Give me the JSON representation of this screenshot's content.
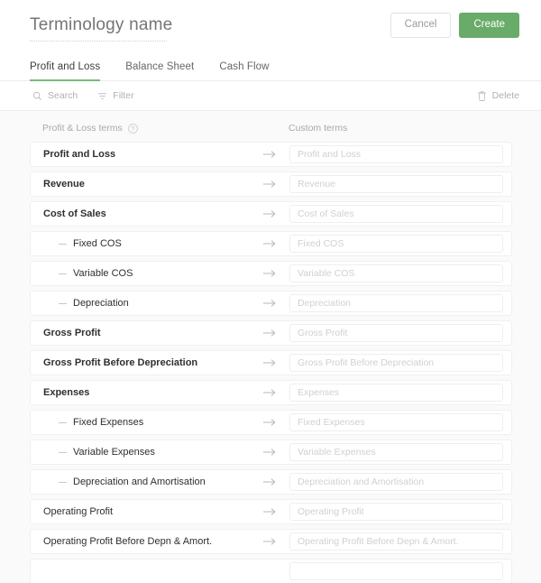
{
  "header": {
    "title_value": "",
    "title_placeholder": "Terminology name",
    "cancel_label": "Cancel",
    "create_label": "Create",
    "accent_color": "#69ab69"
  },
  "tabs": [
    {
      "label": "Profit and Loss",
      "active": true
    },
    {
      "label": "Balance Sheet",
      "active": false
    },
    {
      "label": "Cash Flow",
      "active": false
    }
  ],
  "toolbar": {
    "search_label": "Search",
    "filter_label": "Filter",
    "delete_label": "Delete"
  },
  "columns": {
    "left_label": "Profit & Loss terms",
    "left_help": "?",
    "right_label": "Custom terms"
  },
  "rows": [
    {
      "label": "Profit and Loss",
      "placeholder": "Profit and Loss",
      "value": "",
      "level": 0
    },
    {
      "label": "Revenue",
      "placeholder": "Revenue",
      "value": "",
      "level": 0
    },
    {
      "label": "Cost of Sales",
      "placeholder": "Cost of Sales",
      "value": "",
      "level": 0
    },
    {
      "label": "Fixed COS",
      "placeholder": "Fixed COS",
      "value": "",
      "level": 1
    },
    {
      "label": "Variable COS",
      "placeholder": "Variable COS",
      "value": "",
      "level": 1
    },
    {
      "label": "Depreciation",
      "placeholder": "Depreciation",
      "value": "",
      "level": 1
    },
    {
      "label": "Gross Profit",
      "placeholder": "Gross Profit",
      "value": "",
      "level": 0
    },
    {
      "label": "Gross Profit Before Depreciation",
      "placeholder": "Gross Profit Before Depreciation",
      "value": "",
      "level": 0
    },
    {
      "label": "Expenses",
      "placeholder": "Expenses",
      "value": "",
      "level": 0
    },
    {
      "label": "Fixed Expenses",
      "placeholder": "Fixed Expenses",
      "value": "",
      "level": 1
    },
    {
      "label": "Variable Expenses",
      "placeholder": "Variable Expenses",
      "value": "",
      "level": 1
    },
    {
      "label": "Depreciation and Amortisation",
      "placeholder": "Depreciation and Amortisation",
      "value": "",
      "level": 1
    },
    {
      "label": "Operating Profit",
      "placeholder": "Operating Profit",
      "value": "",
      "level": 2
    },
    {
      "label": "Operating Profit Before Depn & Amort.",
      "placeholder": "Operating Profit Before Depn & Amort.",
      "value": "",
      "level": 2
    },
    {
      "label": "",
      "placeholder": "",
      "value": "",
      "level": 0
    }
  ],
  "icons": {
    "search": "search-icon",
    "filter": "filter-icon",
    "delete": "trash-icon",
    "row_arrow": "arrow-right-icon",
    "help": "help-circle-icon"
  }
}
